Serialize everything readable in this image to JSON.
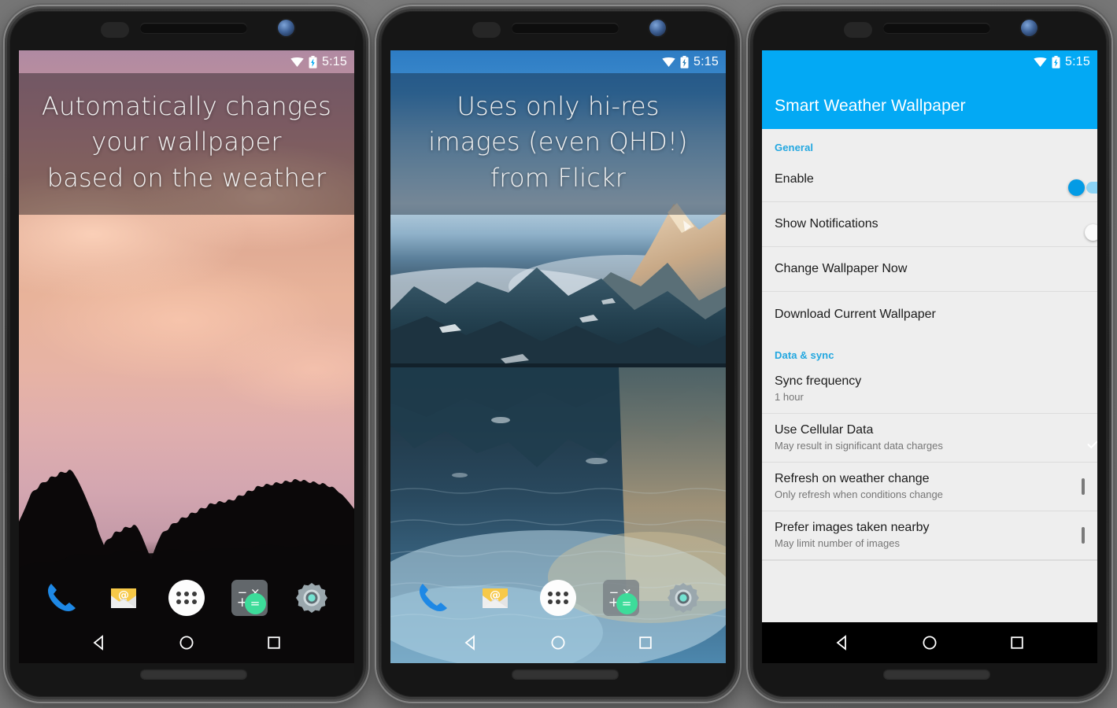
{
  "statusbar": {
    "time": "5:15",
    "wifi_icon": "wifi-icon",
    "battery_icon": "battery-charging-icon"
  },
  "navbar": {
    "back": "back-nav-icon",
    "home": "home-nav-icon",
    "recents": "recents-nav-icon"
  },
  "phones": [
    {
      "name": "phone-1-homescreen",
      "caption_lines": [
        "Automatically changes",
        "your wallpaper",
        "based on the weather"
      ],
      "wallpaper": "pink sunset sky with tree silhouettes"
    },
    {
      "name": "phone-2-homescreen",
      "caption_lines": [
        "Uses only hi-res",
        "images (even QHD!)",
        "from Flickr"
      ],
      "wallpaper": "mountain range reflected in a lake"
    }
  ],
  "dock": {
    "items": [
      {
        "icon": "phone-dialer-icon",
        "label": "Phone"
      },
      {
        "icon": "email-icon",
        "label": "Email"
      },
      {
        "icon": "app-drawer-icon",
        "label": "Apps"
      },
      {
        "icon": "calculator-icon",
        "label": "Calculator"
      },
      {
        "icon": "settings-gear-icon",
        "label": "Settings"
      }
    ],
    "calculator": {
      "minus": "−",
      "times": "×",
      "plus": "+",
      "equals": "="
    },
    "email": {
      "glyph": "@"
    }
  },
  "settings_app": {
    "title": "Smart Weather Wallpaper",
    "accent_color": "#03a9f4",
    "category_color": "#22a7e0",
    "background_color": "#eeeeee",
    "sections": [
      {
        "header": "General",
        "rows": [
          {
            "title": "Enable",
            "subtitle": "",
            "control": "switch",
            "state": "on"
          },
          {
            "title": "Show Notifications",
            "subtitle": "",
            "control": "switch",
            "state": "off"
          },
          {
            "title": "Change Wallpaper Now",
            "subtitle": "",
            "control": "none",
            "state": ""
          },
          {
            "title": "Download Current Wallpaper",
            "subtitle": "",
            "control": "none",
            "state": ""
          }
        ]
      },
      {
        "header": "Data & sync",
        "rows": [
          {
            "title": "Sync frequency",
            "subtitle": "1 hour",
            "control": "none",
            "state": ""
          },
          {
            "title": "Use Cellular Data",
            "subtitle": "May result in significant data charges",
            "control": "checkbox",
            "state": "checked"
          },
          {
            "title": "Refresh on weather change",
            "subtitle": "Only refresh when conditions change",
            "control": "checkbox",
            "state": "unchecked"
          },
          {
            "title": "Prefer images taken nearby",
            "subtitle": "May limit number of images",
            "control": "checkbox",
            "state": "unchecked"
          }
        ]
      }
    ]
  }
}
